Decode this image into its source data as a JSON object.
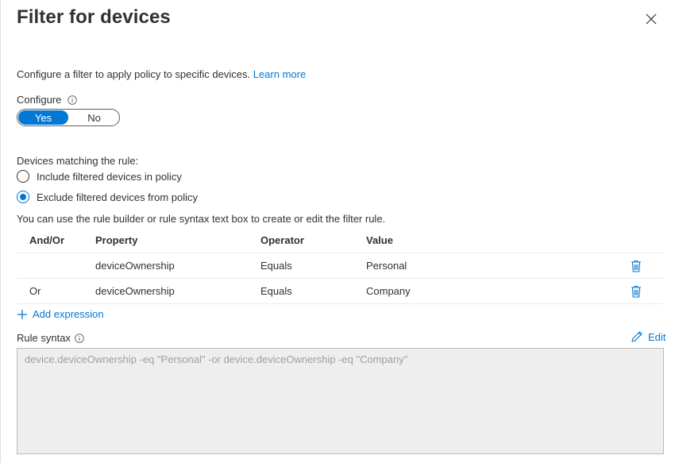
{
  "panel": {
    "title": "Filter for devices",
    "description": "Configure a filter to apply policy to specific devices.",
    "learn_more": "Learn more"
  },
  "configure": {
    "label": "Configure",
    "options": [
      "Yes",
      "No"
    ],
    "selected": "Yes"
  },
  "matching": {
    "label": "Devices matching the rule:",
    "options": [
      "Include filtered devices in policy",
      "Exclude filtered devices from policy"
    ],
    "selected": "Exclude filtered devices from policy"
  },
  "hint": "You can use the rule builder or rule syntax text box to create or edit the filter rule.",
  "table": {
    "headers": [
      "And/Or",
      "Property",
      "Operator",
      "Value"
    ],
    "rows": [
      [
        "",
        "deviceOwnership",
        "Equals",
        "Personal"
      ],
      [
        "Or",
        "deviceOwnership",
        "Equals",
        "Company"
      ]
    ]
  },
  "add_expression": "Add expression",
  "rule_syntax": {
    "label": "Rule syntax",
    "edit": "Edit",
    "value": "device.deviceOwnership -eq \"Personal\" -or device.deviceOwnership -eq \"Company\""
  },
  "colors": {
    "accent": "#0078d4",
    "text": "#323130",
    "disabled_bg": "#eeeeee"
  },
  "icons": [
    "close-icon",
    "info-icon",
    "delete-icon",
    "add-icon",
    "edit-icon"
  ]
}
